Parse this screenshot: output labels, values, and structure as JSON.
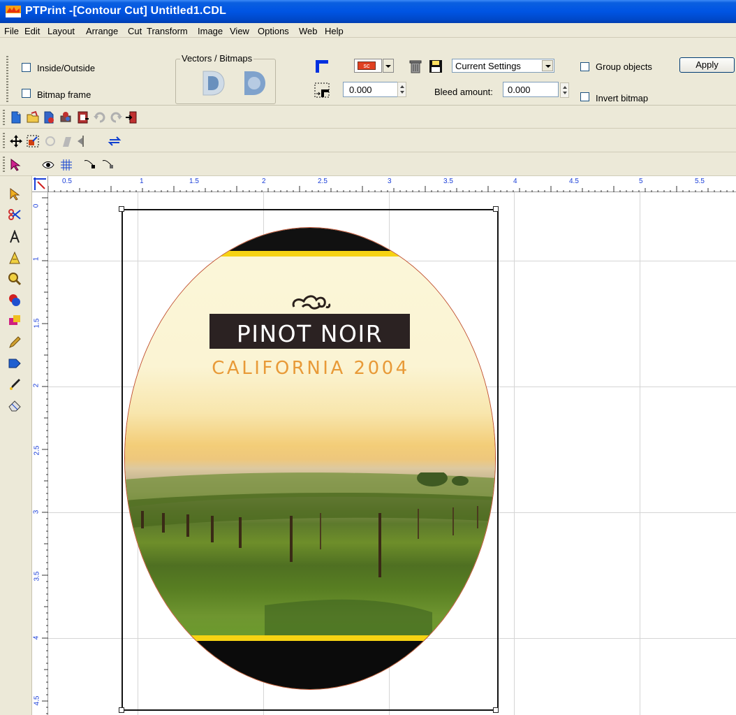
{
  "window": {
    "title": "PTPrint -[Contour Cut] Untitled1.CDL"
  },
  "menu": [
    "File",
    "Edit",
    "Layout",
    "Arrange",
    "Cut",
    "Transform",
    "Image",
    "View",
    "Options",
    "Web",
    "Help"
  ],
  "properties": {
    "inside_outside_label": "Inside/Outside",
    "bitmap_frame_label": "Bitmap frame",
    "vectors_bitmaps_label": "Vectors / Bitmaps",
    "color_button_label": "sc",
    "offset_value": "0.000",
    "preset_value": "Current Settings",
    "bleed_label": "Bleed amount:",
    "bleed_value": "0.000",
    "group_objects_label": "Group objects",
    "invert_bitmap_label": "Invert bitmap",
    "apply_label": "Apply"
  },
  "ruler": {
    "top": [
      "0.5",
      "1",
      "1.5",
      "2",
      "2.5",
      "3",
      "3.5",
      "4",
      "4.5",
      "5",
      "5.5"
    ],
    "left": [
      "0",
      "1",
      "1.5",
      "2",
      "2.5",
      "3",
      "3.5",
      "4",
      "4.5"
    ]
  },
  "label": {
    "title": "PINOT NOIR",
    "subtitle": "CALIFORNIA 2004"
  },
  "colors": {
    "accent_yellow": "#f6d313",
    "title_box": "#2b2222",
    "subtitle_orange": "#e89a38"
  }
}
